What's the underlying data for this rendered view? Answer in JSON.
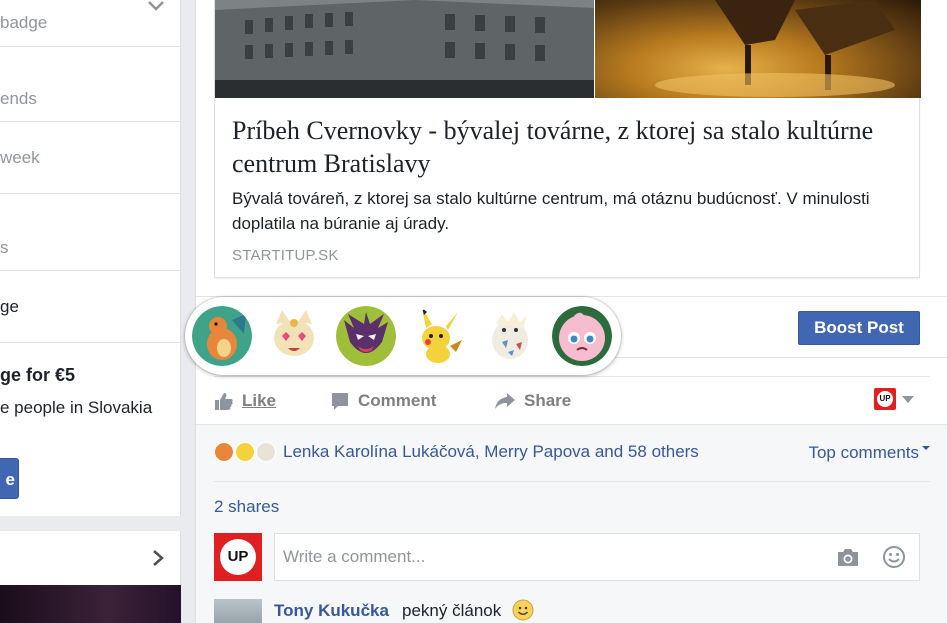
{
  "sidebar": {
    "lines": [
      "badge",
      "ends",
      "week",
      "s",
      "ge"
    ],
    "promo_title": "ge for €5",
    "promo_subtitle": "e people in Slovakia",
    "promo_button": "e"
  },
  "post": {
    "link_preview": {
      "title": "Príbeh Cvernovky - bývalej továrne, z ktorej sa stalo kultúrne centrum Bratislavy",
      "description": "Bývalá továreň, z ktorej sa stalo kultúrne centrum, má otáznu budúcnosť. V minulosti doplatila na búranie aj úrady.",
      "domain": "STARTITUP.SK"
    },
    "boost_button": "Boost Post",
    "actions": {
      "like": "Like",
      "comment": "Comment",
      "share": "Share"
    },
    "page_logo_text": "UP",
    "reactions_summary": "Lenka Karolína Lukáčová, Merry Papova and 58 others",
    "top_comments": "Top comments",
    "shares": "2 shares",
    "comment_input": {
      "placeholder": "Write a comment...",
      "avatar_text": "UP"
    },
    "first_comment": {
      "author": "Tony Kukučka",
      "text": "pekný článok"
    }
  },
  "reactions": [
    {
      "name": "charizard",
      "color": "#e8873a"
    },
    {
      "name": "meowth",
      "color": "#f2e2b8"
    },
    {
      "name": "haunter",
      "color": "#6a3f7a"
    },
    {
      "name": "pikachu",
      "color": "#f4d23b"
    },
    {
      "name": "togepi",
      "color": "#e9e3d7"
    },
    {
      "name": "jigglypuff",
      "color": "#f6bcd0"
    }
  ],
  "colors": {
    "brand_blue": "#4267b2",
    "link_blue": "#365899",
    "up_red": "#e02020"
  }
}
